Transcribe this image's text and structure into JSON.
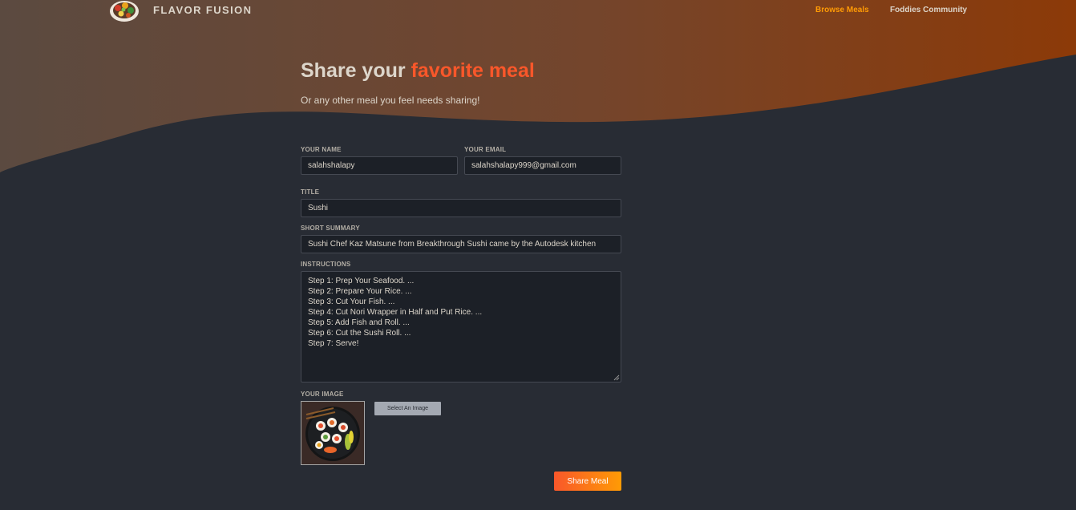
{
  "brand": {
    "name": "FLAVOR FUSION",
    "logo_icon": "food-plate-icon"
  },
  "nav": {
    "items": [
      {
        "label": "Browse Meals",
        "active": true
      },
      {
        "label": "Foddies Community",
        "active": false
      }
    ]
  },
  "hero": {
    "title_prefix": "Share your ",
    "title_highlight": "favorite meal",
    "subtitle": "Or any other meal you feel needs sharing!"
  },
  "form": {
    "name": {
      "label": "YOUR NAME",
      "value": "salahshalapy"
    },
    "email": {
      "label": "YOUR EMAIL",
      "value": "salahshalapy999@gmail.com"
    },
    "title": {
      "label": "TITLE",
      "value": "Sushi"
    },
    "summary": {
      "label": "SHORT SUMMARY",
      "value": "Sushi Chef Kaz Matsune from Breakthrough Sushi came by the Autodesk kitchen"
    },
    "instructions": {
      "label": "INSTRUCTIONS",
      "lines": [
        "Step 1: Prep Your Seafood. ...",
        "Step 2: Prepare Your Rice. ...",
        "Step 3: Cut Your Fish. ...",
        "Step 4: Cut Nori Wrapper in Half and Put Rice. ...",
        "Step 5: Add Fish and Roll. ...",
        "Step 6: Cut the Sushi Roll. ...",
        "Step 7: Serve!"
      ]
    },
    "image": {
      "label": "YOUR IMAGE",
      "select_label": "Select An Image",
      "preview_icon": "sushi-plate-image"
    },
    "submit_label": "Share Meal"
  },
  "colors": {
    "background": "#282c34",
    "accent_start": "#f9572a",
    "accent_end": "#ff9b05",
    "header_gradient_start": "#5e4a3f",
    "header_gradient_end": "#8a3a0b"
  }
}
